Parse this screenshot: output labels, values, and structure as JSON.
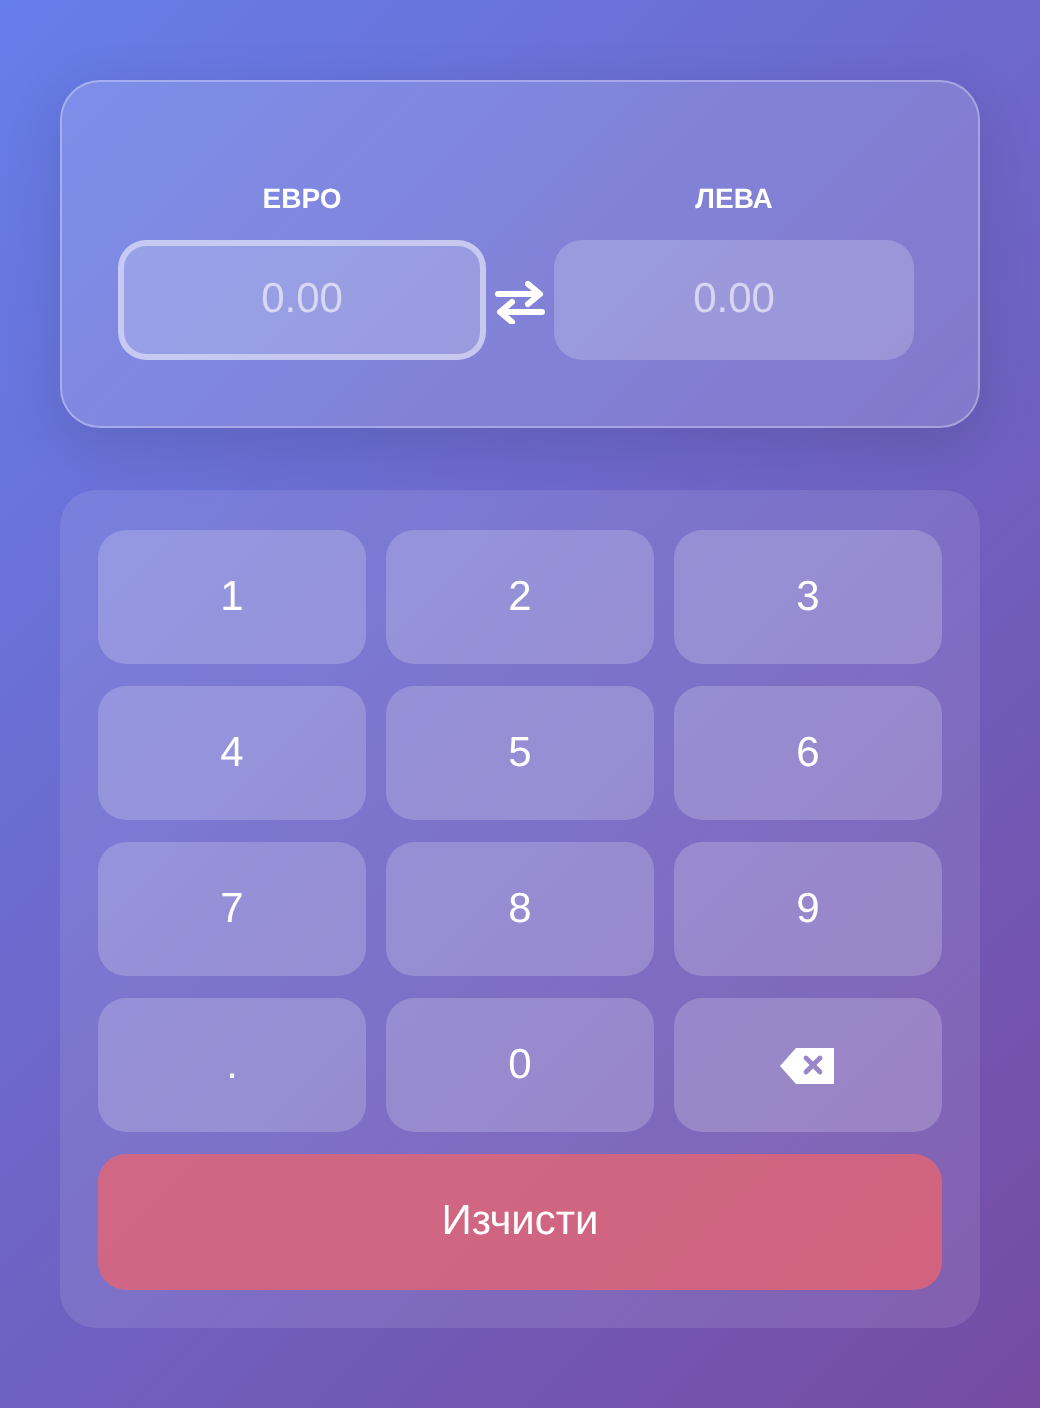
{
  "converter": {
    "fields": [
      {
        "label": "ЕВРО",
        "placeholder": "0.00",
        "selected": true
      },
      {
        "label": "ЛЕВА",
        "placeholder": "0.00",
        "selected": false
      }
    ]
  },
  "keypad": {
    "keys": [
      {
        "kind": "digit",
        "label": "1"
      },
      {
        "kind": "digit",
        "label": "2"
      },
      {
        "kind": "digit",
        "label": "3"
      },
      {
        "kind": "digit",
        "label": "4"
      },
      {
        "kind": "digit",
        "label": "5"
      },
      {
        "kind": "digit",
        "label": "6"
      },
      {
        "kind": "digit",
        "label": "7"
      },
      {
        "kind": "digit",
        "label": "8"
      },
      {
        "kind": "digit",
        "label": "9"
      },
      {
        "kind": "digit",
        "label": "."
      },
      {
        "kind": "digit",
        "label": "0"
      },
      {
        "kind": "backspace"
      }
    ],
    "clear_button": "Изчисти"
  }
}
